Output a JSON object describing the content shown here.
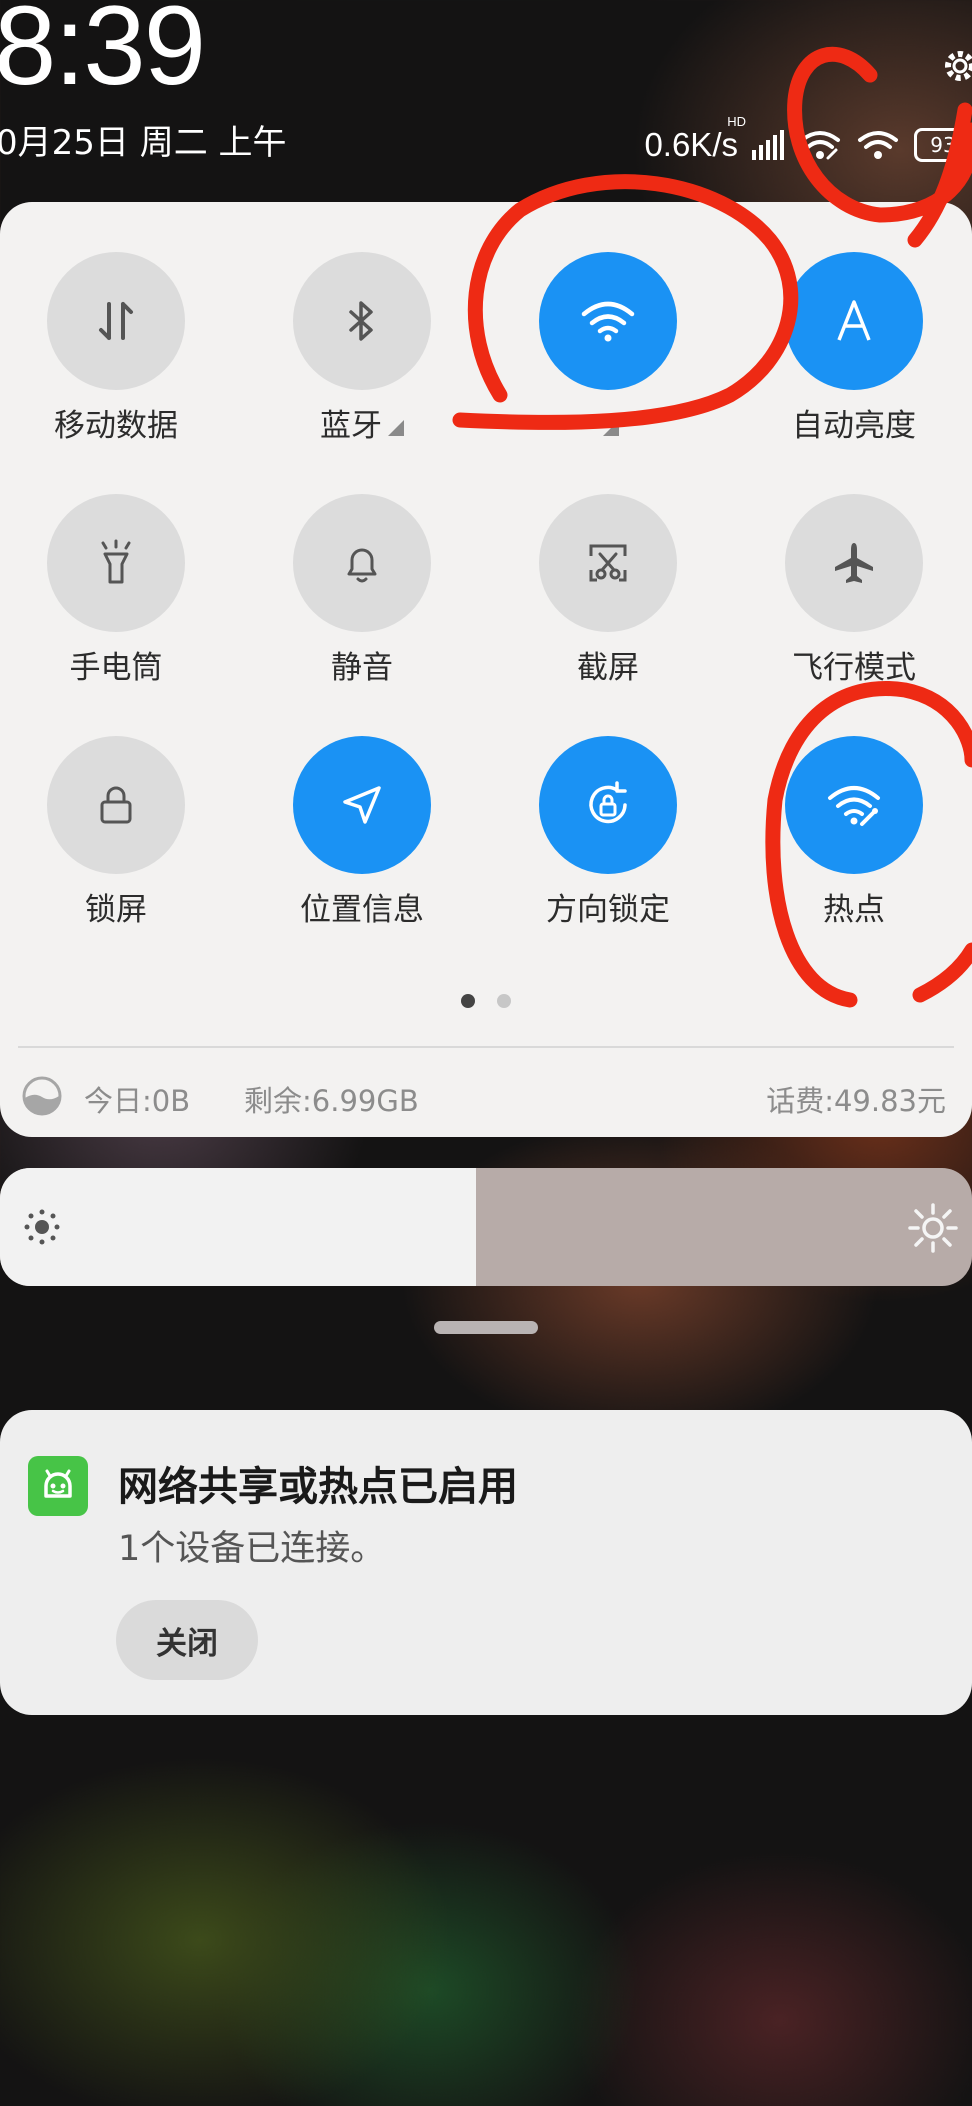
{
  "status_bar": {
    "time": "8:39",
    "date": "0月25日 周二 上午",
    "net_speed": "0.6K/s",
    "net_badge": "HD",
    "battery": "93",
    "icons": [
      "signal-icon",
      "wifi-hotspot-icon",
      "wifi-icon",
      "battery-icon",
      "gear-icon"
    ]
  },
  "quick_settings": {
    "tiles": [
      {
        "label": "移动数据",
        "icon": "mobile-data-icon",
        "state": "off"
      },
      {
        "label": "蓝牙",
        "icon": "bluetooth-icon",
        "state": "off",
        "has_arrow": true
      },
      {
        "label": "",
        "icon": "wifi-icon",
        "state": "on",
        "has_arrow": true
      },
      {
        "label": "自动亮度",
        "icon": "auto-brightness-icon",
        "state": "on"
      },
      {
        "label": "手电筒",
        "icon": "flashlight-icon",
        "state": "off"
      },
      {
        "label": "静音",
        "icon": "bell-icon",
        "state": "off"
      },
      {
        "label": "截屏",
        "icon": "screenshot-icon",
        "state": "off"
      },
      {
        "label": "飞行模式",
        "icon": "airplane-icon",
        "state": "off"
      },
      {
        "label": "锁屏",
        "icon": "lock-icon",
        "state": "off"
      },
      {
        "label": "位置信息",
        "icon": "location-icon",
        "state": "on"
      },
      {
        "label": "方向锁定",
        "icon": "rotation-lock-icon",
        "state": "on"
      },
      {
        "label": "热点",
        "icon": "hotspot-icon",
        "state": "on"
      }
    ],
    "page_count": 2,
    "current_page": 1
  },
  "data_usage": {
    "today": "今日:0B",
    "remaining": "剩余:6.99GB",
    "fee": "话费:49.83元"
  },
  "brightness": {
    "level": 0.49
  },
  "notification": {
    "title": "网络共享或热点已启用",
    "body": "1个设备已连接。",
    "action": "关闭",
    "app_icon": "android-robot-icon"
  },
  "colors": {
    "accent": "#1a92f4",
    "tile_off": "#dcdcdc",
    "annotation": "#ee2a14"
  }
}
